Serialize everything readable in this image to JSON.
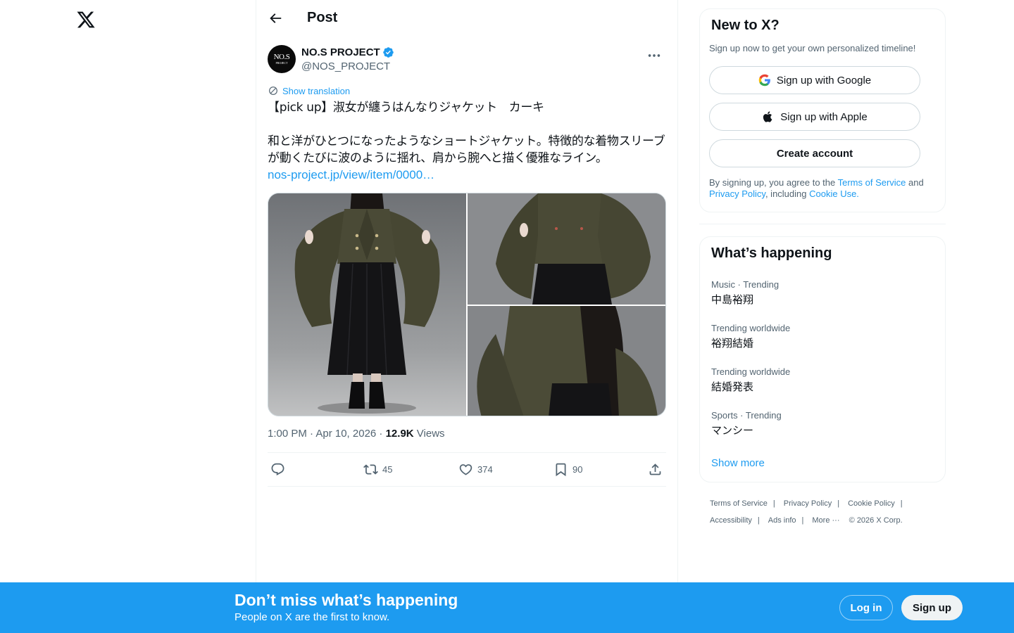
{
  "header": {
    "title": "Post"
  },
  "post": {
    "author_name": "NO.S PROJECT",
    "author_handle": "@NOS_PROJECT",
    "avatar_text": "NO.S",
    "avatar_subtext": "PROJECT",
    "show_translation": "Show translation",
    "text": "【pick up】淑女が纏うはんなりジャケット　カーキ\n\n和と洋がひとつになったようなショートジャケット。特徴的な着物スリーブが動くたびに波のように揺れ、肩から腕へと描く優雅なライン。",
    "link": "nos-project.jp/view/item/0000…",
    "timestamp": "1:00 PM · Apr 10, 2026 · ",
    "views_count": "12.9K",
    "views_label": " Views",
    "retweets": "45",
    "likes": "374",
    "bookmarks": "90"
  },
  "signup": {
    "title": "New to X?",
    "subtitle": "Sign up now to get your own personalized timeline!",
    "google": "Sign up with Google",
    "apple": "Sign up with Apple",
    "create": "Create account",
    "terms_prefix": "By signing up, you agree to the ",
    "terms_link": "Terms of Service",
    "terms_and": " and ",
    "privacy_link": "Privacy Policy",
    "terms_including": ", including ",
    "cookie_link": "Cookie Use."
  },
  "trends": {
    "title": "What’s happening",
    "items": [
      {
        "context": "Music · Trending",
        "name": "中島裕翔"
      },
      {
        "context": "Trending worldwide",
        "name": "裕翔結婚"
      },
      {
        "context": "Trending worldwide",
        "name": "結婚発表"
      },
      {
        "context": "Sports · Trending",
        "name": "マンシー"
      }
    ],
    "show_more": "Show more"
  },
  "footer": {
    "tos": "Terms of Service",
    "privacy": "Privacy Policy",
    "cookie": "Cookie Policy",
    "accessibility": "Accessibility",
    "ads": "Ads info",
    "more": "More ···",
    "copyright": "© 2026 X Corp."
  },
  "banner": {
    "title": "Don’t miss what’s happening",
    "subtitle": "People on X are the first to know.",
    "login": "Log in",
    "signup": "Sign up"
  },
  "colors": {
    "accent": "#1d9bf0",
    "text": "#0f1419",
    "muted": "#536471",
    "jacket": "#4a4a38"
  }
}
